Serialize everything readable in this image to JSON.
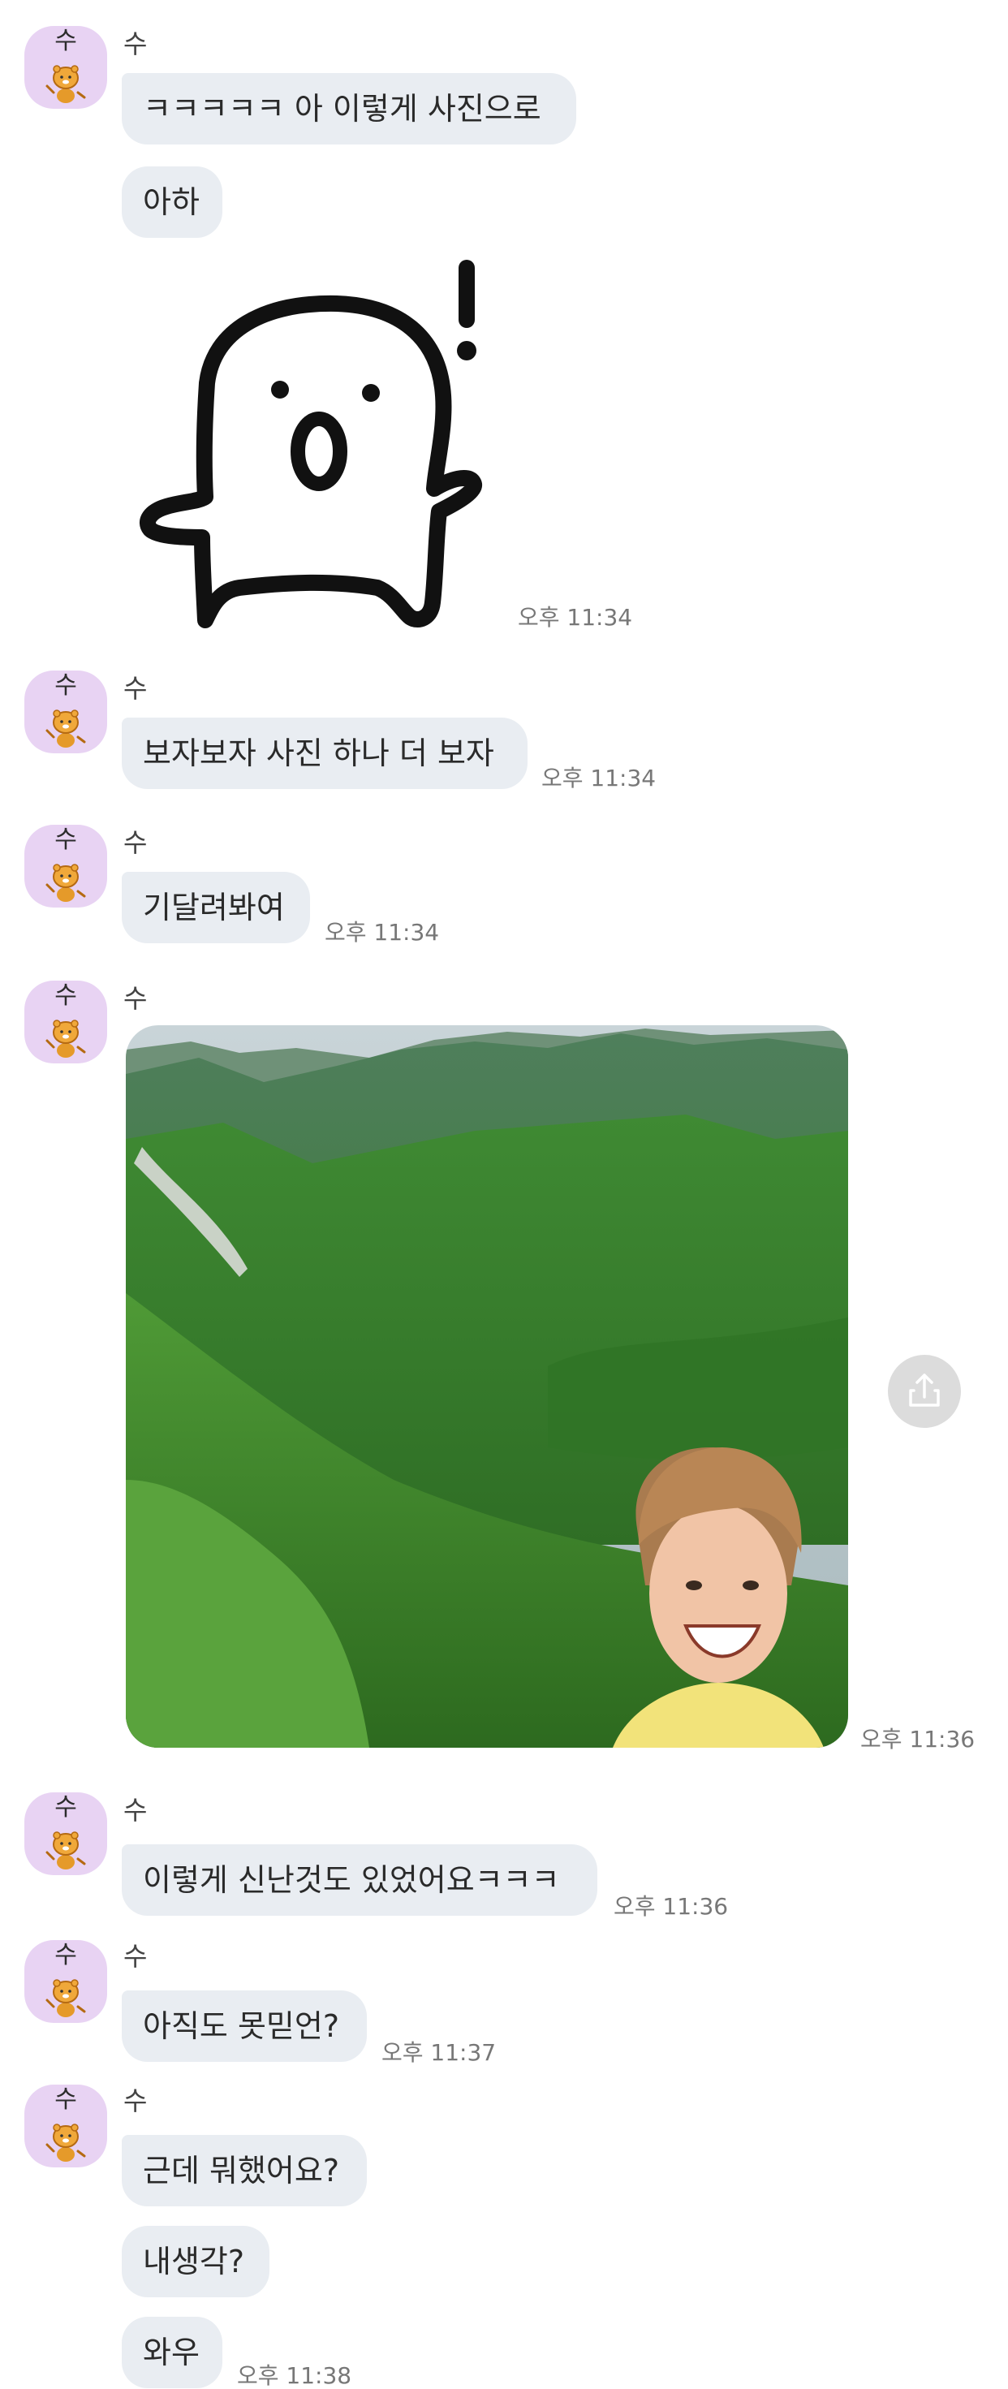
{
  "sender_name": "수",
  "avatar_char": "수",
  "messages": {
    "g1": {
      "b1": "ㅋㅋㅋㅋㅋ 아 이렇게 사진으로",
      "b2": "아하",
      "time": "오후 11:34"
    },
    "g2": {
      "b1": "보자보자 사진 하나 더 보자",
      "time": "오후 11:34"
    },
    "g3": {
      "b1": "기달려봐여",
      "time": "오후 11:34"
    },
    "g4": {
      "time": "오후 11:36"
    },
    "g5": {
      "b1": "이렇게 신난것도 있었어요ㅋㅋㅋ",
      "time": "오후 11:36"
    },
    "g6": {
      "b1": "아직도 못믿언?",
      "time": "오후 11:37"
    },
    "g7": {
      "b1": "근데 뭐했어요?",
      "b2": "내생각?",
      "b3": "와우",
      "time": "오후 11:38"
    }
  },
  "icons": {
    "avatar": "kakao-ryan-avatar-icon",
    "sticker": "surprised-ghost-sticker",
    "share": "share-icon"
  },
  "colors": {
    "bubble": "#e9edf2",
    "avatar_bg": "#e8d3f3",
    "time_text": "#777777",
    "share_button": "#dcdcdc"
  }
}
